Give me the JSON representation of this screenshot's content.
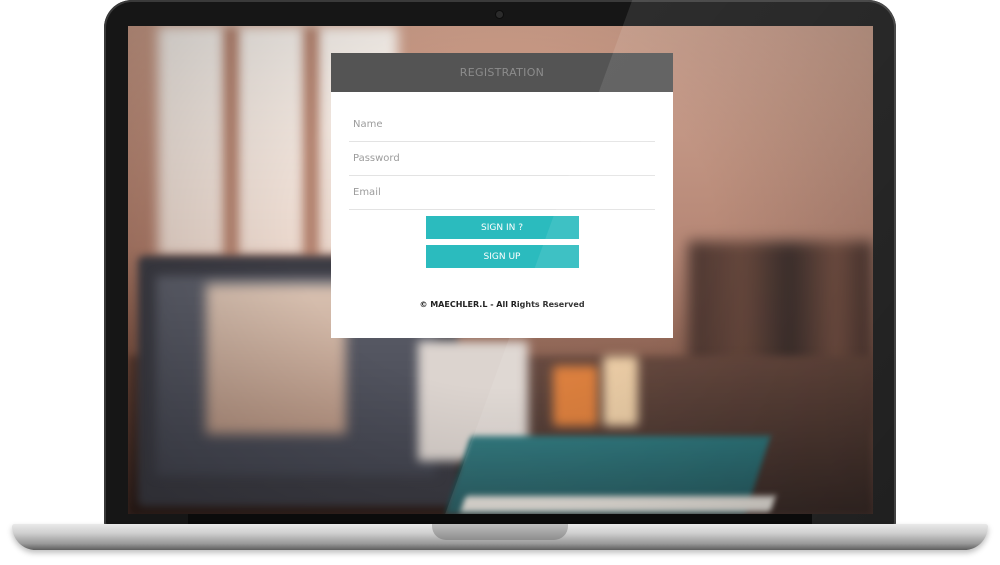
{
  "registration": {
    "title": "REGISTRATION",
    "fields": {
      "name_placeholder": "Name",
      "password_placeholder": "Password",
      "email_placeholder": "Email"
    },
    "buttons": {
      "sign_in_label": "SIGN IN ?",
      "sign_up_label": "SIGN UP"
    },
    "footer": "© MAECHLER.L - All Rights Reserved"
  },
  "colors": {
    "accent": "#2bbbbe",
    "header_bg": "#3c3c3c",
    "card_bg": "#ffffff"
  },
  "icons": {
    "device": "laptop-icon"
  }
}
